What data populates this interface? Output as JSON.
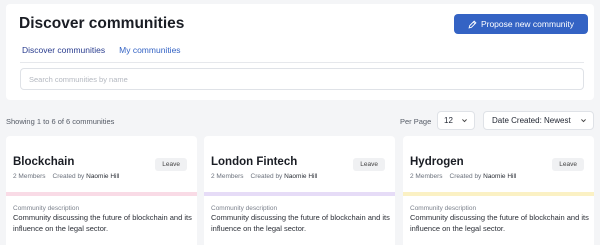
{
  "page": {
    "title": "Discover communities",
    "propose_button": "Propose new community",
    "tabs": [
      {
        "label": "Discover communities",
        "active": true
      },
      {
        "label": "My communities",
        "active": false
      }
    ],
    "search_placeholder": "Search communities by name"
  },
  "results": {
    "showing_text": "Showing 1 to 6 of 6 communities",
    "per_page_label": "Per Page",
    "per_page_value": "12",
    "sort_value": "Date Created: Newest"
  },
  "communities": [
    {
      "name": "Blockchain",
      "leave_label": "Leave",
      "members": "2 Members",
      "created_by_label": "Created by",
      "creator": "Naomie Hill",
      "strip_color": "#f9dbe6",
      "description_label": "Community description",
      "description": "Community discussing the future of blockchain and its influence on the legal sector."
    },
    {
      "name": "London Fintech",
      "leave_label": "Leave",
      "members": "2 Members",
      "created_by_label": "Created by",
      "creator": "Naomie Hill",
      "strip_color": "#e6dcf7",
      "description_label": "Community description",
      "description": "Community discussing the future of blockchain and its influence on the legal sector."
    },
    {
      "name": "Hydrogen",
      "leave_label": "Leave",
      "members": "2 Members",
      "created_by_label": "Created by",
      "creator": "Naomie Hill",
      "strip_color": "#fbf1c4",
      "description_label": "Community description",
      "description": "Community discussing the future of blockchain and its influence on the legal sector."
    }
  ],
  "colors": {
    "accent": "#3463c4",
    "tab_active": "#2a3d8f",
    "background": "#f4f5f7"
  },
  "icons": {
    "propose": "pencil-icon",
    "dropdown": "chevron-down-icon"
  }
}
